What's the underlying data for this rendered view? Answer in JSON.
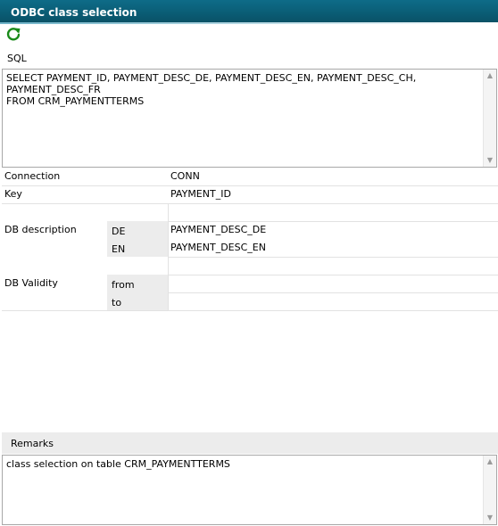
{
  "window": {
    "title": "ODBC class selection"
  },
  "toolbar": {
    "refresh_icon": "refresh-icon"
  },
  "sql": {
    "label": "SQL",
    "text": "SELECT PAYMENT_ID, PAYMENT_DESC_DE, PAYMENT_DESC_EN, PAYMENT_DESC_CH, PAYMENT_DESC_FR\nFROM CRM_PAYMENTTERMS"
  },
  "form": {
    "connection": {
      "label": "Connection",
      "value": "CONN"
    },
    "key": {
      "label": "Key",
      "value": "PAYMENT_ID"
    },
    "db_description": {
      "label": "DB description",
      "rows": [
        {
          "lang": "DE",
          "value": "PAYMENT_DESC_DE"
        },
        {
          "lang": "EN",
          "value": "PAYMENT_DESC_EN"
        }
      ]
    },
    "db_validity": {
      "label": "DB Validity",
      "from_label": "from",
      "to_label": "to",
      "from_value": "",
      "to_value": ""
    }
  },
  "remarks": {
    "label": "Remarks",
    "text": "class selection on table CRM_PAYMENTTERMS"
  },
  "colors": {
    "titlebar": "#0a5b73",
    "refresh_icon": "#1a8a1a",
    "gray_panel": "#ececec",
    "border": "#a8a8a8"
  }
}
